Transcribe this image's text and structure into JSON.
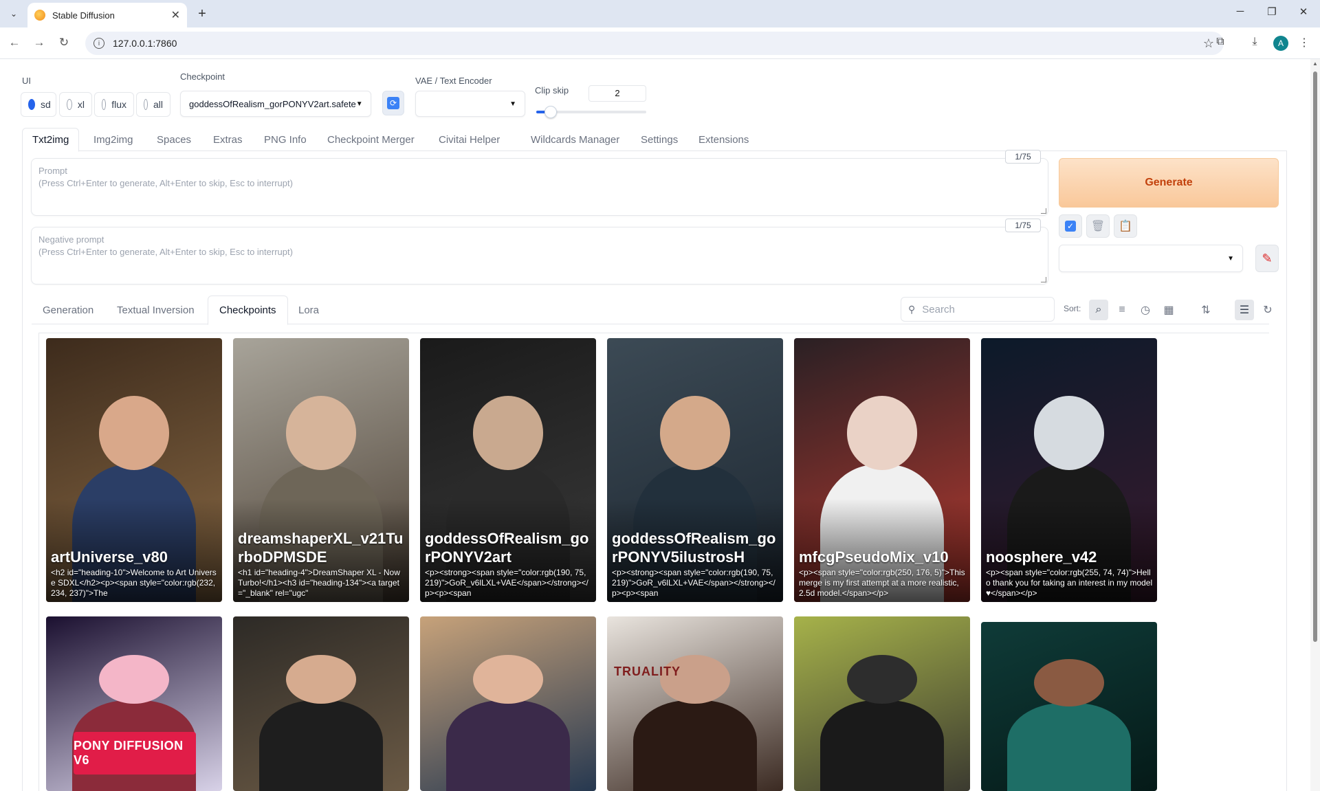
{
  "browser": {
    "tab_title": "Stable Diffusion",
    "url": "127.0.0.1:7860",
    "avatar_letter": "A"
  },
  "ui_section": {
    "label": "UI",
    "options": [
      "sd",
      "xl",
      "flux",
      "all"
    ],
    "selected": "sd"
  },
  "checkpoint": {
    "label": "Checkpoint",
    "value": "goddessOfRealism_gorPONYV2art.safete"
  },
  "vae": {
    "label": "VAE / Text Encoder",
    "value": ""
  },
  "clip_skip": {
    "label": "Clip skip",
    "value": "2"
  },
  "main_tabs": [
    "Txt2img",
    "Img2img",
    "Spaces",
    "Extras",
    "PNG Info",
    "Checkpoint Merger",
    "Civitai Helper",
    "Wildcards Manager",
    "Settings",
    "Extensions"
  ],
  "prompt": {
    "label": "Prompt",
    "placeholder": "(Press Ctrl+Enter to generate, Alt+Enter to skip, Esc to interrupt)",
    "token_count": "1/75"
  },
  "negative_prompt": {
    "label": "Negative prompt",
    "placeholder": "(Press Ctrl+Enter to generate, Alt+Enter to skip, Esc to interrupt)",
    "token_count": "1/75"
  },
  "generate_label": "Generate",
  "sub_tabs": [
    "Generation",
    "Textual Inversion",
    "Checkpoints",
    "Lora"
  ],
  "search_placeholder": "Search",
  "sort_label": "Sort:",
  "cards_row1": [
    {
      "title": "artUniverse_v80",
      "desc": "<h2 id=\"heading-10\">Welcome to Art Universe SDXL</h2><p><span style=\"color:rgb(232, 234, 237)\">The",
      "bg1": "#3d2b1c",
      "bg2": "#8a6a45",
      "skin": "#d9a88a",
      "cloth": "#2b3e66"
    },
    {
      "title": "dreamshaperXL_v21TurboDPMSDE",
      "desc": "<h1 id=\"heading-4\">DreamShaper XL - Now Turbo!</h1><h3 id=\"heading-134\"><a target=\"_blank\" rel=\"ugc\"",
      "bg1": "#a8a49a",
      "bg2": "#4b3f33",
      "skin": "#d6b49a",
      "cloth": "#6e6658"
    },
    {
      "title": "goddessOfRealism_gorPONYV2art",
      "desc": "<p><strong><span style=\"color:rgb(190, 75, 219)\">GoR_v6lLXL+VAE</span></strong></p><p><span",
      "bg1": "#1a1a1a",
      "bg2": "#3a3a3a",
      "skin": "#c9a98f",
      "cloth": "#2a2a2a"
    },
    {
      "title": "goddessOfRealism_gorPONYV5ilustrosH",
      "desc": "<p><strong><span style=\"color:rgb(190, 75, 219)\">GoR_v6lLXL+VAE</span></strong></p><p><span",
      "bg1": "#3c4a55",
      "bg2": "#1c2630",
      "skin": "#d4a98a",
      "cloth": "#22303c"
    },
    {
      "title": "mfcgPseudoMix_v10",
      "desc": "<p><span style=\"color:rgb(250, 176, 5)\">This merge is my first attempt at a more realistic, 2.5d model.</span></p>",
      "bg1": "#2a2024",
      "bg2": "#b83a30",
      "skin": "#ead2c6",
      "cloth": "#f0f0f0"
    },
    {
      "title": "noosphere_v42",
      "desc": "<p><span style=\"color:rgb(255, 74, 74)\">Hello thank you for taking an interest in my model ♥</span></p>",
      "bg1": "#0c1a2a",
      "bg2": "#3a1a2e",
      "skin": "#d6dbe0",
      "cloth": "#1a1a1a"
    }
  ],
  "cards_row2": [
    {
      "title": "",
      "desc": "",
      "bg1": "#1b1030",
      "bg2": "#d8d2e8",
      "skin": "#f4b6c8",
      "cloth": "#8b2b3a",
      "band": "PONY DIFFUSION V6"
    },
    {
      "title": "",
      "desc": "",
      "bg1": "#2d2a26",
      "bg2": "#6b5a45",
      "skin": "#d6ab8f",
      "cloth": "#1e1e1e"
    },
    {
      "title": "",
      "desc": "",
      "bg1": "#c7a27a",
      "bg2": "#263850",
      "skin": "#e0b49a",
      "cloth": "#3b2a4a"
    },
    {
      "title": "",
      "desc": "",
      "bg1": "#e9e4de",
      "bg2": "#3b2a22",
      "skin": "#caa08a",
      "cloth": "#2b1a14",
      "brand": "TRUALITY"
    },
    {
      "title": "",
      "desc": "",
      "bg1": "#a6b24a",
      "bg2": "#3b3a30",
      "skin": "#2d2d2d",
      "cloth": "#1a1a1a"
    },
    {
      "title": "",
      "desc": "",
      "bg1": "#0f3b38",
      "bg2": "#051a18",
      "skin": "#8a5a42",
      "cloth": "#1e6e66"
    }
  ]
}
